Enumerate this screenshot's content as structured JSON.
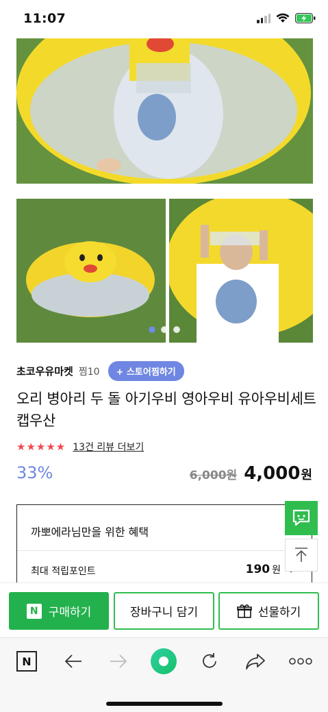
{
  "status": {
    "time": "11:07"
  },
  "store": {
    "name": "초코우유마켓",
    "zzim": "찜10",
    "zzim_button": "+ 스토어찜하기"
  },
  "product": {
    "title": "오리 병아리 두 돌 아기우비 영아우비 유아우비세트 캡우산",
    "rating_stars": "★★★★★",
    "review_link": "13건 리뷰 더보기",
    "discount": "33%",
    "original_price": "6,000원",
    "sale_price": "4,000",
    "sale_unit": "원"
  },
  "gallery": {
    "dots": 3,
    "active_index": 0
  },
  "benefit": {
    "title": "까뽀에라님만을 위한 혜택",
    "point_label": "최대 적립포인트",
    "point_value": "190",
    "point_unit": "원"
  },
  "actions": {
    "buy_badge": "N",
    "buy_label": "구매하기",
    "cart_label": "장바구니 담기",
    "gift_label": "선물하기"
  },
  "browser": {
    "naver_badge": "N"
  },
  "colors": {
    "accent": "#6f87e2",
    "buy_green": "#23b14d",
    "star_red": "#f2474b"
  }
}
